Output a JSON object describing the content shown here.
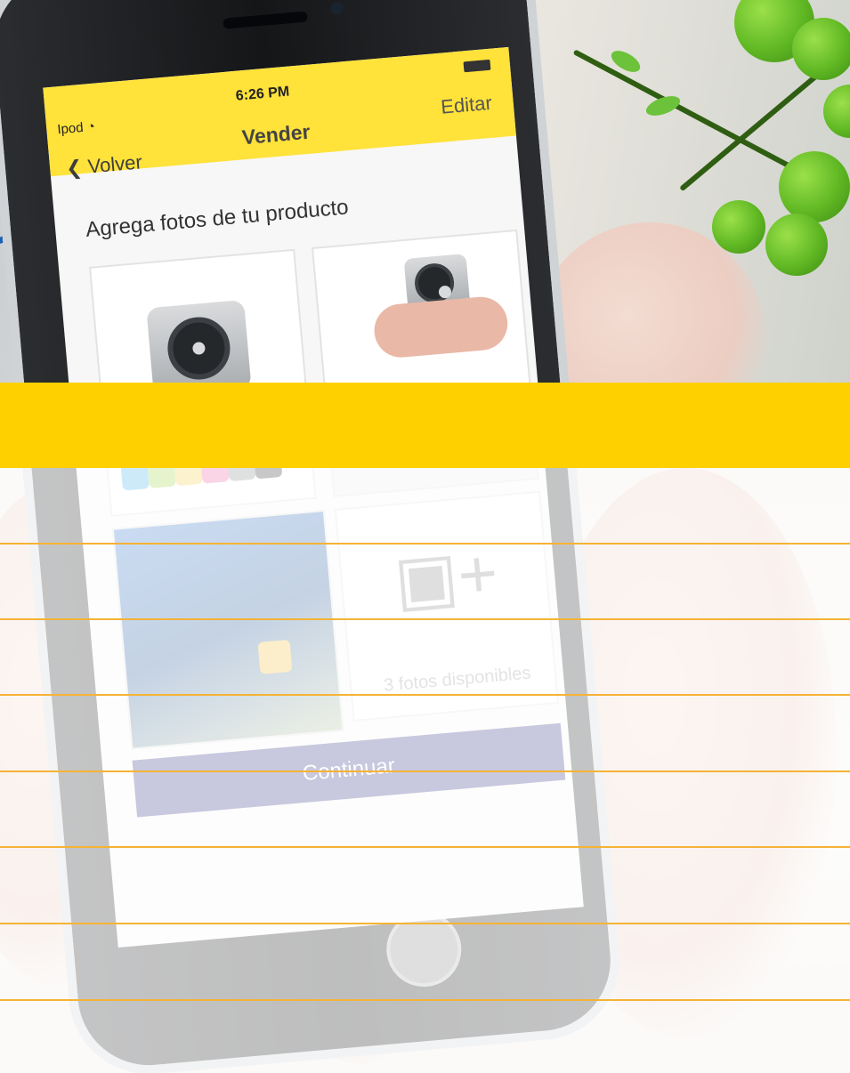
{
  "status_bar": {
    "carrier": "Ipod",
    "wifi_icon": "wifi-icon",
    "time": "6:26 PM",
    "battery_icon": "battery-icon"
  },
  "nav": {
    "back_label": "Volver",
    "back_icon": "chevron-left-icon",
    "title": "Vender",
    "edit_label": "Editar"
  },
  "content": {
    "heading": "Agrega fotos de tu producto",
    "photos": [
      {
        "name": "ipod-front-photo"
      },
      {
        "name": "ipod-in-hand-photo"
      },
      {
        "name": "ipod-colors-photo"
      },
      {
        "name": "ipod-clipped-on-shirt-photo"
      }
    ],
    "add_photo": {
      "icon": "camera-plus-icon",
      "available_text": "3 fotos disponibles"
    },
    "continue_label": "Continuar"
  },
  "colors": {
    "band_yellow": "#ffd000",
    "nav_yellow": "#ffe23a",
    "rule_orange": "#f5b335",
    "button_navy": "#39398a"
  }
}
